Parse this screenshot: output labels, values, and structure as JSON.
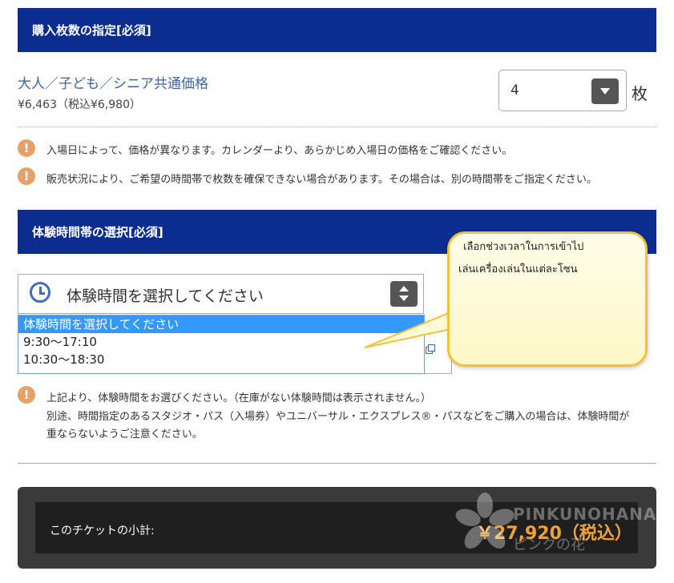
{
  "quantity_section": {
    "header": "購入枚数の指定[必須]",
    "ticket_name": "大人／子ども／シニア共通価格",
    "ticket_price": "¥6,463（税込¥6,980）",
    "quantity_value": "4",
    "quantity_unit": "枚"
  },
  "notices": [
    "入場日によって、価格が異なります。カレンダーより、あらかじめ入場日の価格をご確認ください。",
    "販売状況により、ご希望の時間帯で枚数を確保できない場合があります。その場合は、別の時間帯をご指定ください。"
  ],
  "time_section": {
    "header": "体験時間帯の選択[必須]",
    "select_placeholder": "体験時間を選択してください",
    "options": [
      "体験時間を選択してください",
      "9:30～17:10",
      "10:30～18:30"
    ],
    "selected_index": 0
  },
  "tooltip": {
    "line1": "เลือกช่วงเวลาในการเข้าไป",
    "line2": "เล่นเครื่องเล่นในแต่ละโซน",
    "background": "#fff8c8",
    "border_color": "#f2c23a"
  },
  "bottom_notice": {
    "line1": "上記より、体験時間をお選びください。（在庫がない体験時間は表示されません。）",
    "line2": "別途、時間指定のあるスタジオ・パス（入場券）やユニバーサル・エクスプレス®・パスなどをご購入の場合は、体験時間が",
    "line3": "重ならないようご注意ください。"
  },
  "subtotal": {
    "label": "このチケットの小計:",
    "value": "￥27,920（税込）"
  },
  "watermark": {
    "text": "PINKUNOHANA",
    "sub": "ピンクの花"
  },
  "colors": {
    "header_bg": "#0a2d8f",
    "ticket_name": "#3d63a6",
    "warning_icon": "#e6a06a",
    "subtotal_value": "#f0a23a",
    "dropdown_highlight": "#3399ff"
  },
  "icons": {
    "warning": "exclamation-circle-icon",
    "clock": "clock-icon",
    "select_arrow": "chevron-down-icon",
    "select_updown": "up-down-arrows-icon",
    "popout": "external-window-icon"
  }
}
